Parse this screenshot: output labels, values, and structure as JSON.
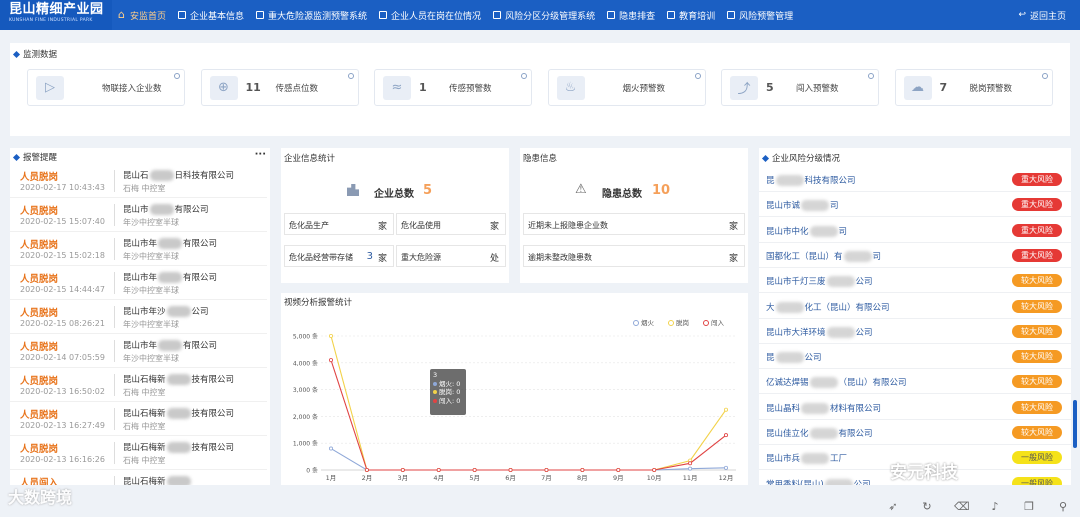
{
  "header": {
    "logo_title": "昆山精细产业园",
    "logo_sub": "KUNSHAN FINE INDUSTRIAL PARK",
    "nav": [
      {
        "label": "安监首页",
        "active": true
      },
      {
        "label": "企业基本信息",
        "active": false
      },
      {
        "label": "重大危险源监测预警系统",
        "active": false
      },
      {
        "label": "企业人员在岗在位情况",
        "active": false
      },
      {
        "label": "风险分区分级管理系统",
        "active": false
      },
      {
        "label": "隐患排查",
        "active": false
      },
      {
        "label": "教育培训",
        "active": false
      },
      {
        "label": "风险预警管理",
        "active": false
      }
    ],
    "back": "返回主页"
  },
  "monitor": {
    "title": "监测数据",
    "cards": [
      {
        "icon": "video-icon",
        "glyph": "▷",
        "value": "",
        "label": "物联接入企业数"
      },
      {
        "icon": "globe-icon",
        "glyph": "⊕",
        "value": "11",
        "label": "传感点位数"
      },
      {
        "icon": "signal-icon",
        "glyph": "≈",
        "value": "1",
        "label": "传感预警数"
      },
      {
        "icon": "fire-icon",
        "glyph": "♨",
        "value": "",
        "label": "烟火预警数"
      },
      {
        "icon": "runner-icon",
        "glyph": "⤴",
        "value": "5",
        "label": "闯入预警数"
      },
      {
        "icon": "cloud-icon",
        "glyph": "☁",
        "value": "7",
        "label": "脱岗预警数"
      }
    ]
  },
  "alarms": {
    "title": "报警提醒",
    "more": "···",
    "items": [
      {
        "type": "人员脱岗",
        "time": "2020-02-17 10:43:43",
        "company": "昆山石",
        "suffix": "日科技有限公司",
        "location": "石梅 中控室"
      },
      {
        "type": "人员脱岗",
        "time": "2020-02-15 15:07:40",
        "company": "昆山市",
        "suffix": "有限公司",
        "location": "年沙中控室半球"
      },
      {
        "type": "人员脱岗",
        "time": "2020-02-15 15:02:18",
        "company": "昆山市年",
        "suffix": "有限公司",
        "location": "年沙中控室半球"
      },
      {
        "type": "人员脱岗",
        "time": "2020-02-15 14:44:47",
        "company": "昆山市年",
        "suffix": "有限公司",
        "location": "年沙中控室半球"
      },
      {
        "type": "人员脱岗",
        "time": "2020-02-15 08:26:21",
        "company": "昆山市年沙",
        "suffix": "公司",
        "location": "年沙中控室半球"
      },
      {
        "type": "人员脱岗",
        "time": "2020-02-14 07:05:59",
        "company": "昆山市年",
        "suffix": "有限公司",
        "location": "年沙中控室半球"
      },
      {
        "type": "人员脱岗",
        "time": "2020-02-13 16:50:02",
        "company": "昆山石梅新",
        "suffix": "技有限公司",
        "location": "石梅 中控室"
      },
      {
        "type": "人员脱岗",
        "time": "2020-02-13 16:27:49",
        "company": "昆山石梅新",
        "suffix": "技有限公司",
        "location": "石梅 中控室"
      },
      {
        "type": "人员脱岗",
        "time": "2020-02-13 16:16:26",
        "company": "昆山石梅新",
        "suffix": "技有限公司",
        "location": "石梅 中控室"
      },
      {
        "type": "人员闯入",
        "time": "",
        "company": "昆山石梅新",
        "suffix": "",
        "location": ""
      }
    ]
  },
  "company_info": {
    "title": "企业信息统计",
    "total_label": "企业总数",
    "total_value": "5",
    "cells": [
      {
        "label": "危化品生产",
        "value": "",
        "unit": "家"
      },
      {
        "label": "危化品使用",
        "value": "",
        "unit": "家"
      },
      {
        "label": "危化品经营带存储",
        "value": "3",
        "unit": "家"
      },
      {
        "label": "重大危险源",
        "value": "",
        "unit": "处"
      }
    ]
  },
  "hazard": {
    "title": "隐患信息",
    "total_label": "隐患总数",
    "total_value": "10",
    "rows": [
      {
        "label": "近期未上报隐患企业数",
        "value": "",
        "unit": "家"
      },
      {
        "label": "逾期未整改隐患数",
        "value": "",
        "unit": "家"
      }
    ]
  },
  "video_chart": {
    "title": "视频分析报警统计",
    "tooltip": {
      "title": "3",
      "rows": [
        {
          "label": "烟火: 0",
          "color": "#8fa8d8"
        },
        {
          "label": "脱岗: 0",
          "color": "#f2d24a"
        },
        {
          "label": "闯入: 0",
          "color": "#e04343"
        }
      ]
    }
  },
  "chart_data": {
    "type": "line",
    "categories": [
      "1月",
      "2月",
      "3月",
      "4月",
      "5月",
      "6月",
      "7月",
      "8月",
      "9月",
      "10月",
      "11月",
      "12月"
    ],
    "series": [
      {
        "name": "烟火",
        "color": "#8fa8d8",
        "values": [
          800,
          0,
          0,
          0,
          0,
          0,
          0,
          0,
          0,
          0,
          50,
          80
        ]
      },
      {
        "name": "脱岗",
        "color": "#f2d24a",
        "values": [
          5000,
          0,
          0,
          0,
          0,
          0,
          0,
          0,
          0,
          0,
          350,
          2250
        ]
      },
      {
        "name": "闯入",
        "color": "#e04343",
        "values": [
          4100,
          0,
          0,
          0,
          0,
          0,
          0,
          0,
          0,
          0,
          250,
          1300
        ]
      }
    ],
    "yticks": [
      "0 条",
      "1,000 条",
      "2,000 条",
      "3,000 条",
      "4,000 条",
      "5,000 条"
    ],
    "ylim": [
      0,
      5000
    ]
  },
  "risk": {
    "title": "企业风险分级情况",
    "colors": {
      "重大风险": "#e53935",
      "较大风险": "#f59a23",
      "一般风险": "#f5e21a"
    },
    "items": [
      {
        "name": "昆",
        "suffix": "科技有限公司",
        "level": "重大风险"
      },
      {
        "name": "昆山市诚",
        "suffix": "司",
        "level": "重大风险"
      },
      {
        "name": "昆山市中化",
        "suffix": "司",
        "level": "重大风险"
      },
      {
        "name": "国都化工（昆山）有",
        "suffix": "司",
        "level": "重大风险"
      },
      {
        "name": "昆山市千灯三废",
        "suffix": "公司",
        "level": "较大风险"
      },
      {
        "name": "大",
        "suffix": "化工（昆山）有限公司",
        "level": "较大风险"
      },
      {
        "name": "昆山市大洋环境",
        "suffix": "公司",
        "level": "较大风险"
      },
      {
        "name": "昆",
        "suffix": "公司",
        "level": "较大风险"
      },
      {
        "name": "亿诚达焊锡",
        "suffix": "（昆山）有限公司",
        "level": "较大风险"
      },
      {
        "name": "昆山晶科",
        "suffix": "材料有限公司",
        "level": "较大风险"
      },
      {
        "name": "昆山佳立化",
        "suffix": "有限公司",
        "level": "较大风险"
      },
      {
        "name": "昆山市兵",
        "suffix": "工厂",
        "level": "一般风险"
      },
      {
        "name": "常用香料(昆山)",
        "suffix": "公司",
        "level": "一般风险"
      }
    ]
  },
  "watermarks": {
    "left": "大数跨境",
    "right": "安元科技"
  }
}
